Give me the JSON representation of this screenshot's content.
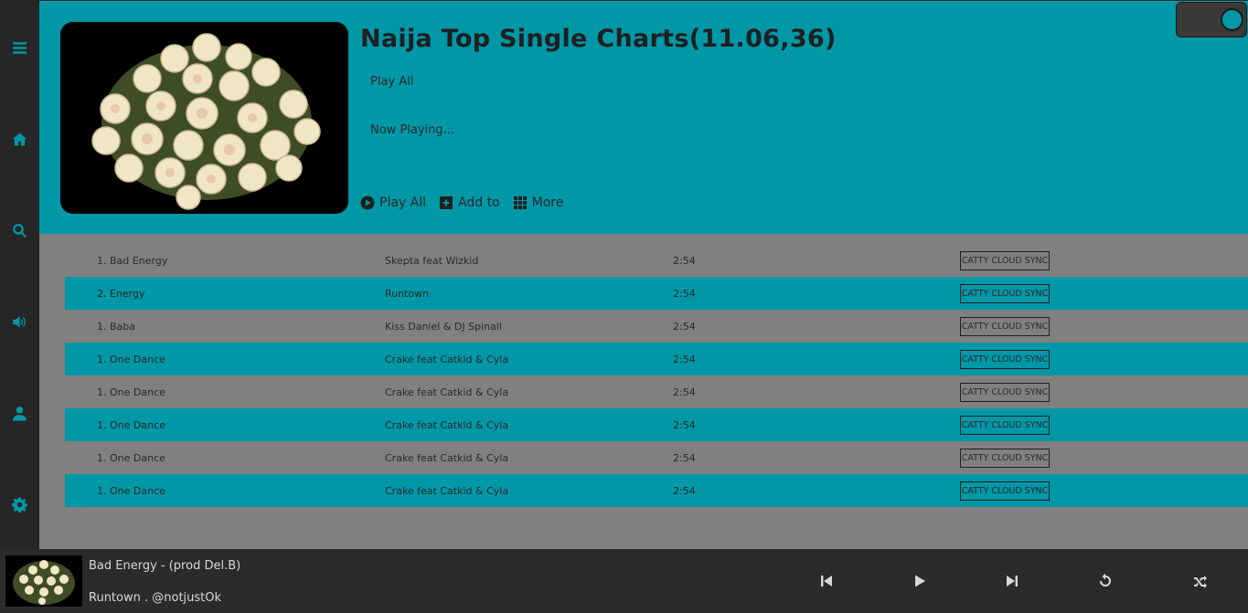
{
  "sidebar": {
    "items": [
      {
        "icon": "menu-icon"
      },
      {
        "icon": "home-icon"
      },
      {
        "icon": "search-icon"
      },
      {
        "icon": "volume-icon"
      },
      {
        "icon": "user-icon"
      },
      {
        "icon": "gear-icon"
      }
    ]
  },
  "header": {
    "title": "Naija Top Single Charts(11.06,36)",
    "play_all_link": "Play All",
    "now_playing": "Now Playing...",
    "actions": {
      "play_all": "Play All",
      "add_to": "Add to",
      "more": "More"
    }
  },
  "tracks": [
    {
      "title": "1. Bad Energy",
      "artist": "Skepta feat Wizkid",
      "duration": "2:54",
      "sync": "CATTY CLOUD SYNC"
    },
    {
      "title": "2. Energy",
      "artist": "Runtown",
      "duration": "2:54",
      "sync": "CATTY CLOUD SYNC"
    },
    {
      "title": "1. Baba",
      "artist": "Kiss Daniel & DJ Spinall",
      "duration": "2:54",
      "sync": "CATTY CLOUD SYNC"
    },
    {
      "title": "1. One Dance",
      "artist": "Crake feat Catkid & Cyla",
      "duration": "2:54",
      "sync": "CATTY CLOUD SYNC"
    },
    {
      "title": "1. One Dance",
      "artist": "Crake feat Catkid & Cyla",
      "duration": "2:54",
      "sync": "CATTY CLOUD SYNC"
    },
    {
      "title": "1. One Dance",
      "artist": "Crake feat Catkid & Cyla",
      "duration": "2:54",
      "sync": "CATTY CLOUD SYNC"
    },
    {
      "title": "1. One Dance",
      "artist": "Crake feat Catkid & Cyla",
      "duration": "2:54",
      "sync": "CATTY CLOUD SYNC"
    },
    {
      "title": "1. One Dance",
      "artist": "Crake feat Catkid & Cyla",
      "duration": "2:54",
      "sync": "CATTY CLOUD SYNC"
    }
  ],
  "player": {
    "title": "Bad Energy - (prod Del.B)",
    "artist": "Runtown . @notjustOk"
  },
  "colors": {
    "accent": "#0097a7",
    "sidebar": "#262626",
    "list_bg": "#808080",
    "player_bg": "#2b2b2b"
  }
}
